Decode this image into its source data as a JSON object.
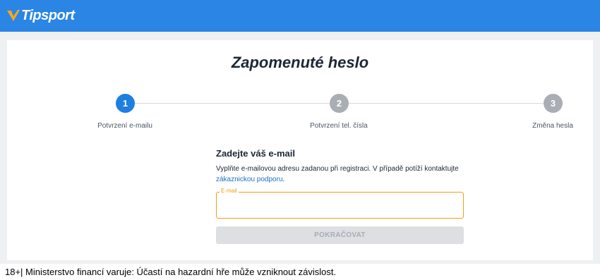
{
  "header": {
    "brand": "Tipsport",
    "background": "#2a85e4",
    "logo_icon": "tipsport-check-icon",
    "logo_color": "#f5a623"
  },
  "main": {
    "title": "Zapomenuté heslo",
    "steps": [
      {
        "number": "1",
        "label": "Potvrzení e-mailu",
        "state": "active"
      },
      {
        "number": "2",
        "label": "Potvrzení tel. čísla",
        "state": "inactive"
      },
      {
        "number": "3",
        "label": "Změna hesla",
        "state": "inactive"
      }
    ],
    "form": {
      "heading": "Zadejte váš e-mail",
      "description": "Vyplňte e-mailovou adresu zadanou při registraci. V případě potíží kontaktujte",
      "support_link": "zákaznickou podporu",
      "description_end": ".",
      "email_label": "E-mail",
      "email_value": "",
      "continue_label": "POKRAČOVAT"
    },
    "colors": {
      "accent": "#1e7fe0",
      "field_focus": "#f29d1a",
      "disabled_button": "#dddfe2"
    }
  },
  "footer": {
    "warning": "18+| Ministerstvo financí varuje: Účastí na hazardní hře může vzniknout závislost."
  }
}
